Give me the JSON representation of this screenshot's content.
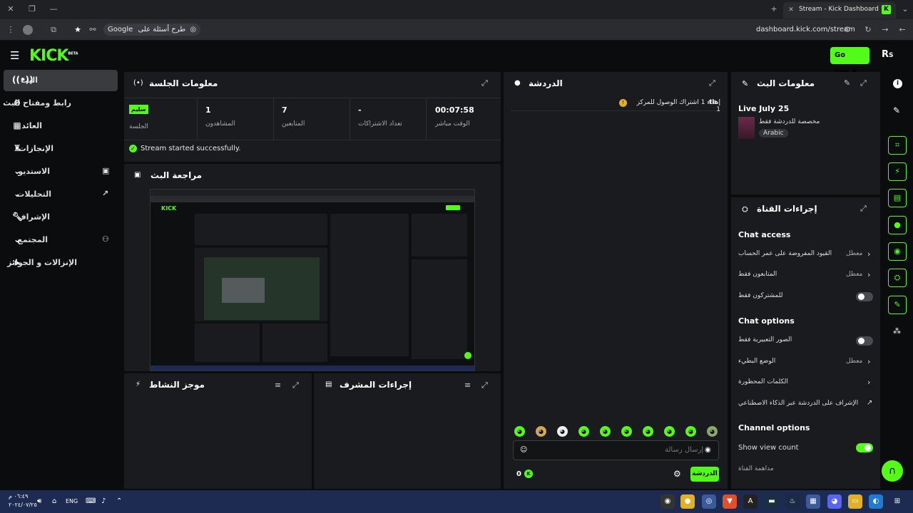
{
  "browser": {
    "tab_title": "Stream - Kick Dashboard",
    "url": "dashboard.kick.com/stream",
    "search_chip": "Google",
    "search_question": "طرح أسئلة على"
  },
  "app": {
    "logo": "KICK",
    "beta": "BETA",
    "go_live": "Go live",
    "brand_color": "#53fc18"
  },
  "sidebar": {
    "items": [
      {
        "label": "البث",
        "icon": "broadcast-icon"
      },
      {
        "label": "رابط ومفتاح البث",
        "icon": "link-icon"
      },
      {
        "label": "العائد",
        "icon": "revenue-icon"
      },
      {
        "label": "الإنجازات",
        "icon": "trophy-icon"
      },
      {
        "label": "الاستديو",
        "icon": "studio-icon"
      },
      {
        "label": "التحليلات",
        "icon": "analytics-icon"
      },
      {
        "label": "الإشراف",
        "icon": "wrench-icon"
      },
      {
        "label": "المجتمع",
        "icon": "community-icon"
      },
      {
        "label": "الإنزالات و الجوائز",
        "icon": "drops-icon"
      }
    ]
  },
  "session": {
    "title": "معلومات الجلسة",
    "badge": "سليم",
    "session_label": "الجلسة",
    "viewers_value": "1",
    "viewers_label": "المشاهدون",
    "followers_value": "7",
    "followers_label": "المتابعين",
    "subs_value": "-",
    "subs_label": "تعداد الاشتراكات",
    "live_time_value": "00:07:58",
    "live_time_label": "الوقت مباشر",
    "status_message": "Stream started successfully."
  },
  "preview": {
    "title": "مراجعة البث"
  },
  "activity": {
    "title": "موجز النشاط"
  },
  "mod_actions": {
    "title": "إجراءات المشرف"
  },
  "chat": {
    "title": "الدردشة",
    "message": "إهداء 1 اشتراك الوصول للمركز 1",
    "message_prefix": "th",
    "input_placeholder": "إرسال رسالة",
    "send_label": "الدردشة",
    "count": "0"
  },
  "stream_info": {
    "title": "معلومات البث",
    "stream_title": "Live July 25",
    "subtitle": "مخصصة للدردشة فقط",
    "language": "Arabic"
  },
  "channel_actions": {
    "title": "إجراءات القناة",
    "chat_access_heading": "Chat access",
    "account_age_label": "القيود المفروضة على عمر الحساب",
    "account_age_value": "معطل",
    "followers_only_label": "المتابعون فقط",
    "followers_only_value": "معطل",
    "subscribers_only_label": "للمشتركون فقط",
    "chat_options_heading": "Chat options",
    "emotes_only_label": "الصور التعبيرية فقط",
    "slow_mode_label": "الوضع البطيء",
    "slow_mode_value": "معطل",
    "banned_words_label": "الكلمات المحظورة",
    "ai_mod_label": "الإشراف على الدردشة عبر الذكاء الاصطناعي",
    "channel_options_heading": "Channel options",
    "show_view_count_label": "Show view count",
    "channel_points_label": "مداهمة القناة"
  },
  "taskbar": {
    "time": "٠٦:٤٩ م",
    "date": "٢٠٢٤/٠٧/٢٥",
    "lang": "ENG"
  }
}
